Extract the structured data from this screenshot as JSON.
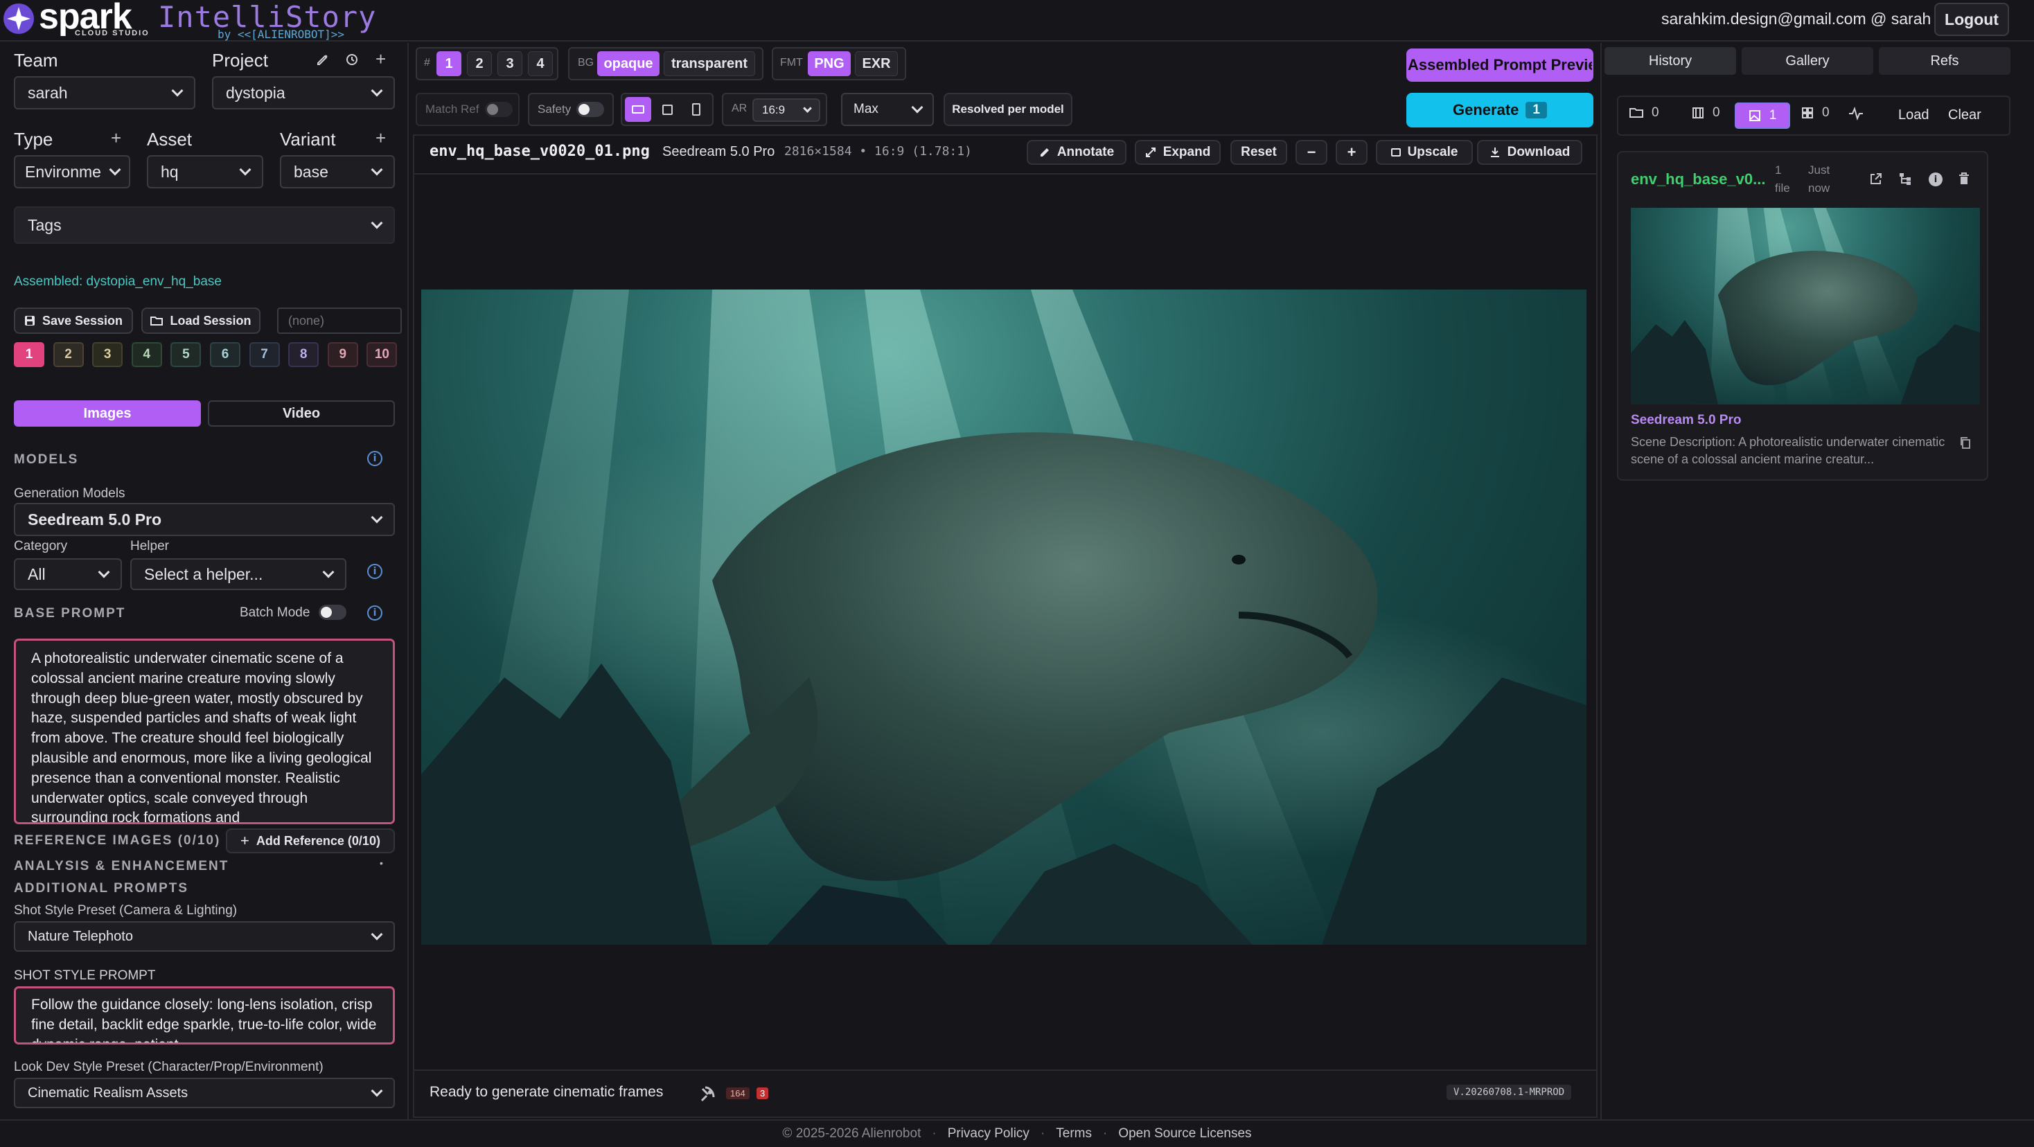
{
  "header": {
    "logo_spark": "spark",
    "logo_sub": "CLOUD STUDIO",
    "logo_intelli": "IntelliStory",
    "logo_by": "by <<[ALIENROBOT]>>",
    "user": "sarahkim.design@gmail.com @ sarah",
    "logout": "Logout"
  },
  "left": {
    "team_label": "Team",
    "team_value": "sarah",
    "project_label": "Project",
    "project_value": "dystopia",
    "type_label": "Type",
    "type_value": "Environme",
    "asset_label": "Asset",
    "asset_value": "hq",
    "variant_label": "Variant",
    "variant_value": "base",
    "tags_label": "Tags",
    "assembled": "Assembled: dystopia_env_hq_base",
    "save_session": "Save Session",
    "load_session": "Load Session",
    "session_placeholder": "(none)",
    "session_slots": [
      "1",
      "2",
      "3",
      "4",
      "5",
      "6",
      "7",
      "8",
      "9",
      "10"
    ],
    "mode_images": "Images",
    "mode_video": "Video",
    "models_heading": "MODELS",
    "generation_models_label": "Generation Models",
    "generation_model_value": "Seedream 5.0 Pro",
    "category_label": "Category",
    "category_value": "All",
    "helper_label": "Helper",
    "helper_value": "Select a helper...",
    "base_prompt_heading": "BASE PROMPT",
    "batch_mode": "Batch Mode",
    "base_prompt": "A photorealistic underwater cinematic scene of a colossal ancient marine creature moving slowly through deep blue-green water, mostly obscured by haze, suspended particles and shafts of weak light from above. The creature should feel biologically plausible and enormous, more like a living geological presence than a conventional monster. Realistic underwater optics, scale conveyed through surrounding rock formations and",
    "reference_images": "REFERENCE IMAGES (0/10)",
    "add_reference": "Add Reference (0/10)",
    "analysis": "ANALYSIS & ENHANCEMENT",
    "additional_prompts": "ADDITIONAL PROMPTS",
    "shot_style_label": "Shot Style Preset (Camera & Lighting)",
    "shot_style_value": "Nature Telephoto",
    "shot_style_prompt_heading": "SHOT STYLE PROMPT",
    "shot_style_prompt": "Follow the guidance closely: long-lens isolation, crisp fine detail, backlit edge sparkle, true-to-life color, wide dynamic range, patient",
    "lookdev_label": "Look Dev Style Preset (Character/Prop/Environment)",
    "lookdev_value": "Cinematic Realism Assets"
  },
  "toolbar": {
    "count_label": "#",
    "counts": [
      "1",
      "2",
      "3",
      "4"
    ],
    "bg_label": "BG",
    "bg_opaque": "opaque",
    "bg_transparent": "transparent",
    "fmt_label": "FMT",
    "fmt_png": "PNG",
    "fmt_exr": "EXR",
    "match_ref": "Match Ref",
    "safety": "Safety",
    "ar_label": "AR",
    "ar_value": "16:9",
    "quality_value": "Max",
    "resolved": "Resolved per model",
    "assembled_preview": "Assembled Prompt Preview",
    "generate": "Generate",
    "generate_count": "1"
  },
  "viewer": {
    "filename": "env_hq_base_v0020_01.png",
    "model": "Seedream 5.0 Pro",
    "meta": "2816×1584 • 16:9 (1.78:1)",
    "annotate": "Annotate",
    "expand": "Expand",
    "reset": "Reset",
    "minus": "−",
    "plus": "+",
    "upscale": "Upscale",
    "download": "Download"
  },
  "status": {
    "text": "Ready to generate cinematic frames",
    "count_a": "164",
    "count_b": "3",
    "version": "V.20260708.1-MRPROD"
  },
  "right": {
    "tab_history": "History",
    "tab_gallery": "Gallery",
    "tab_refs": "Refs",
    "filter_folders": "0",
    "filter_video": "0",
    "filter_images": "1",
    "filter_grid": "0",
    "load": "Load",
    "clear": "Clear",
    "card_title": "env_hq_base_v0...",
    "card_files_1": "1",
    "card_files_2": "file",
    "card_time_1": "Just",
    "card_time_2": "now",
    "card_model": "Seedream 5.0 Pro",
    "card_desc": "Scene Description: A photorealistic underwater cinematic scene of a colossal ancient marine creatur..."
  },
  "footer": {
    "copyright": "© 2025-2026 Alienrobot",
    "privacy": "Privacy Policy",
    "terms": "Terms",
    "licenses": "Open Source Licenses",
    "sep": "·"
  },
  "colors": {
    "accent_purple": "#b15ef5",
    "accent_cyan": "#13c2ec",
    "pink": "#e2437e",
    "teal_link": "#4fc6c1",
    "green_title": "#3fcf6f"
  }
}
